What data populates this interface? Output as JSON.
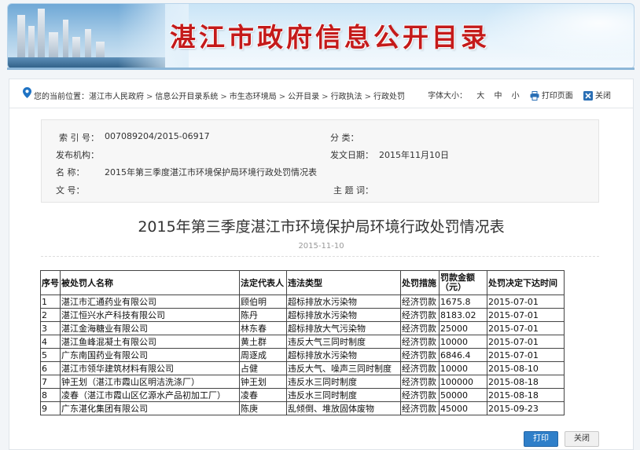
{
  "header": {
    "title": "湛江市政府信息公开目录"
  },
  "breadcrumb": {
    "prefix": "您的当前位置：",
    "items": [
      "湛江市人民政府",
      "信息公开目录系统",
      "市生态环境局",
      "公开目录",
      "行政执法",
      "行政处罚"
    ],
    "separator": ">"
  },
  "tools": {
    "font_size_label": "字体大小：",
    "font_large": "大",
    "font_medium": "中",
    "font_small": "小",
    "print_label": "打印页面",
    "close_label": "关闭"
  },
  "meta": {
    "index_label": "索 引 号：",
    "index_value": "007089204/2015-06917",
    "category_label": "分 类：",
    "category_value": "",
    "publisher_label": "发布机构：",
    "publisher_value": "",
    "date_label": "发文日期：",
    "date_value": "2015年11月10日",
    "name_label": "名 称：",
    "name_value": "2015年第三季度湛江市环境保护局环境行政处罚情况表",
    "docno_label": "文 号：",
    "docno_value": "",
    "subject_label": "主 题 词：",
    "subject_value": ""
  },
  "document": {
    "title": "2015年第三季度湛江市环境保护局环境行政处罚情况表",
    "date": "2015-11-10"
  },
  "table": {
    "headers": [
      "序号",
      "被处罚人名称",
      "法定代表人",
      "违法类型",
      "处罚措施",
      "罚款金额（元）",
      "处罚决定下达时间"
    ],
    "rows": [
      [
        "1",
        "湛江市汇通药业有限公司",
        "顾伯明",
        "超标排放水污染物",
        "经济罚款",
        "1675.8",
        "2015-07-01"
      ],
      [
        "2",
        "湛江恒兴水产科技有限公司",
        "陈丹",
        "超标排放水污染物",
        "经济罚款",
        "8183.02",
        "2015-07-01"
      ],
      [
        "3",
        "湛江金海糖业有限公司",
        "林东春",
        "超标排放大气污染物",
        "经济罚款",
        "25000",
        "2015-07-01"
      ],
      [
        "4",
        "湛江鱼峰混凝土有限公司",
        "黄土群",
        "违反大气三同时制度",
        "经济罚款",
        "10000",
        "2015-07-01"
      ],
      [
        "5",
        "广东南国药业有限公司",
        "周逐成",
        "超标排放水污染物",
        "经济罚款",
        "6846.4",
        "2015-07-01"
      ],
      [
        "6",
        "湛江市领华建筑材料有限公司",
        "占健",
        "违反大气、噪声三同时制度",
        "经济罚款",
        "10000",
        "2015-08-10"
      ],
      [
        "7",
        "钟王划（湛江市霞山区明洁洗涤厂）",
        "钟王划",
        "违反水三同时制度",
        "经济罚款",
        "100000",
        "2015-08-18"
      ],
      [
        "8",
        "凌春（湛江市霞山区亿源水产品初加工厂）",
        "凌春",
        "违反水三同时制度",
        "经济罚款",
        "50000",
        "2015-08-18"
      ],
      [
        "9",
        "广东湛化集团有限公司",
        "陈庚",
        "乱倾倒、堆放固体废物",
        "经济罚款",
        "45000",
        "2015-09-23"
      ]
    ]
  },
  "buttons": {
    "print": "打印",
    "close": "关闭"
  },
  "colors": {
    "banner_title": "#c41a1a",
    "print_button": "#2f7fc9"
  }
}
